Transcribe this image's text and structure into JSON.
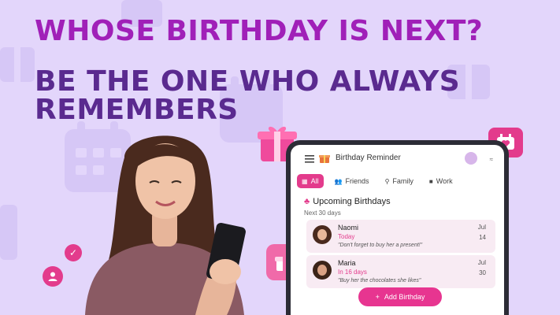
{
  "headline": {
    "line1": "WHOSE BIRTHDAY IS NEXT?",
    "line2": "BE THE ONE WHO ALWAYS REMEMBERS"
  },
  "colors": {
    "background": "#e3d6fb",
    "accent": "#e33b8c",
    "headline1": "#a020b8",
    "headline2": "#5a2a8f"
  },
  "app": {
    "title": "Birthday Reminder",
    "menu_icon": "menu-icon",
    "tabs": [
      {
        "label": "All",
        "icon": "grid-icon",
        "active": true
      },
      {
        "label": "Friends",
        "icon": "people-icon",
        "active": false
      },
      {
        "label": "Family",
        "icon": "family-icon",
        "active": false
      },
      {
        "label": "Work",
        "icon": "briefcase-icon",
        "active": false
      }
    ],
    "section": {
      "title": "Upcoming Birthdays",
      "subtitle": "Next 30 days"
    },
    "birthdays": [
      {
        "name": "Naomi",
        "when": "Today",
        "note": "\"Don't forget to buy her a present!\"",
        "month": "Jul",
        "day": "14"
      },
      {
        "name": "Maria",
        "when": "In 16 days",
        "note": "\"Buy her the chocolates she likes\"",
        "month": "Jul",
        "day": "30"
      }
    ],
    "add_button": {
      "label": "Add Birthday",
      "icon": "plus-icon"
    }
  }
}
